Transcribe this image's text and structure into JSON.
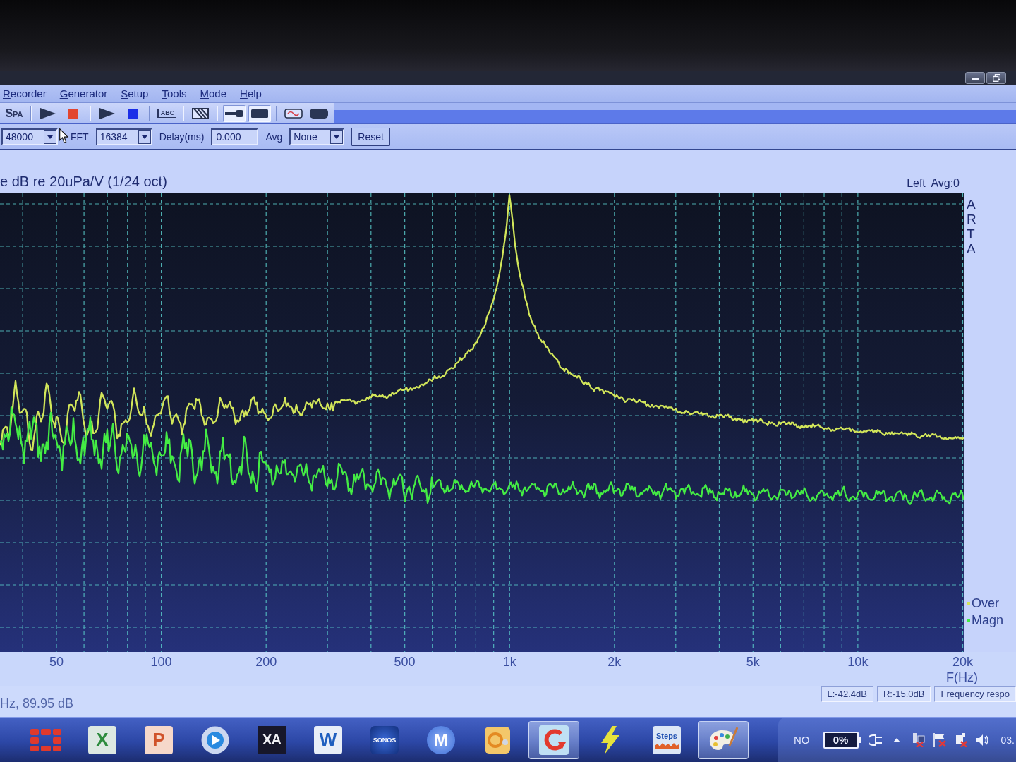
{
  "menu": [
    "Recorder",
    "Generator",
    "Setup",
    "Tools",
    "Mode",
    "Help"
  ],
  "toolbar": {
    "groups": [
      {
        "buttons": [
          {
            "kind": "text",
            "label": "SPA",
            "pressed": false
          }
        ]
      },
      {
        "buttons": [
          {
            "kind": "play",
            "pressed": false
          },
          {
            "kind": "stop",
            "color": "#e2452f",
            "pressed": false
          }
        ]
      },
      {
        "buttons": [
          {
            "kind": "play",
            "pressed": false
          },
          {
            "kind": "stop",
            "color": "#1a2ee8",
            "pressed": false
          }
        ]
      },
      {
        "buttons": [
          {
            "kind": "label",
            "label": "ABC",
            "pressed": false
          }
        ]
      },
      {
        "buttons": [
          {
            "kind": "hatch",
            "pressed": false
          }
        ]
      },
      {
        "buttons": [
          {
            "kind": "probe",
            "pressed": true
          },
          {
            "kind": "block",
            "pressed": true
          }
        ]
      },
      {
        "buttons": [
          {
            "kind": "sine",
            "pressed": false
          },
          {
            "kind": "pill",
            "pressed": false
          }
        ]
      }
    ]
  },
  "controls": {
    "sample_rate": {
      "value": "48000"
    },
    "fft": {
      "label": "FFT",
      "value": "16384"
    },
    "delay": {
      "label": "Delay(ms)",
      "value": "0.000"
    },
    "avg": {
      "label": "Avg",
      "value": "None"
    },
    "reset_button": {
      "label": "Reset"
    }
  },
  "plot": {
    "title": "e dB re 20uPa/V (1/24 oct)",
    "channel_info": "Left Avg:0",
    "side_label": "ARTA",
    "legend": [
      {
        "label": "Over",
        "color": "#d2e65a"
      },
      {
        "label": "Magn",
        "color": "#44ec44"
      }
    ],
    "x_ticks": [
      "50",
      "100",
      "200",
      "500",
      "1k",
      "2k",
      "5k",
      "10k",
      "20k"
    ],
    "x_label": "F(Hz)"
  },
  "status": {
    "cursor_readout": "Hz, 89.95 dB",
    "panes": [
      "L:-42.4dB",
      "R:-15.0dB",
      "Frequency respo"
    ]
  },
  "taskbar": {
    "items": [
      {
        "kind": "blocks",
        "selected": false
      },
      {
        "kind": "sheet",
        "label": "X",
        "selected": false
      },
      {
        "kind": "slides",
        "label": "P",
        "selected": false
      },
      {
        "kind": "disc",
        "selected": false
      },
      {
        "kind": "xa",
        "label": "XA",
        "selected": false
      },
      {
        "kind": "doc",
        "label": "W",
        "selected": false
      },
      {
        "kind": "sonos",
        "label": "SONOS",
        "selected": false
      },
      {
        "kind": "badge",
        "label": "M",
        "selected": false
      },
      {
        "kind": "office",
        "selected": false
      },
      {
        "kind": "cycle",
        "selected": true
      },
      {
        "kind": "bolt",
        "selected": false
      },
      {
        "kind": "steps",
        "label": "Steps",
        "selected": false
      },
      {
        "kind": "palette",
        "selected": true
      }
    ],
    "tray": {
      "language": "NO",
      "battery": "0%",
      "clock": "03."
    }
  }
}
